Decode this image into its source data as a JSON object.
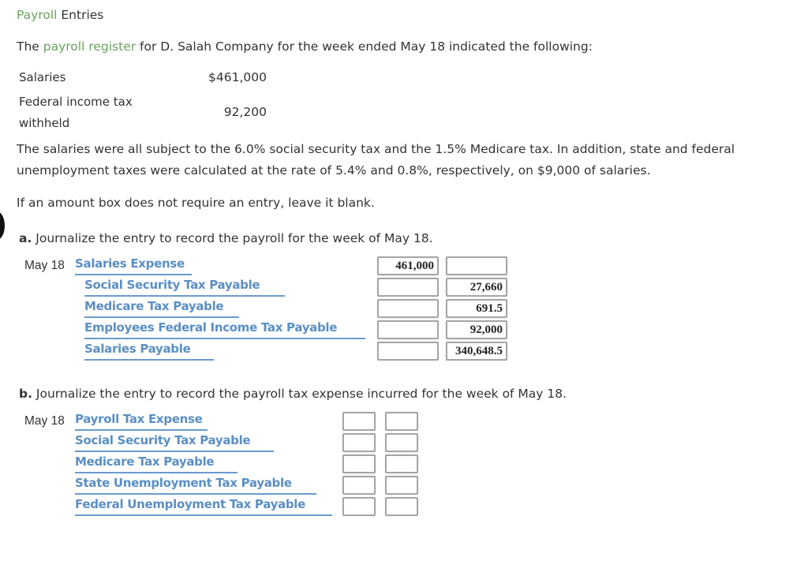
{
  "header": {
    "title_link": "Payroll",
    "title_rest": " Entries"
  },
  "intro": {
    "prefix": "The ",
    "link": "payroll register",
    "suffix": " for D. Salah Company for the week ended May 18 indicated the following:"
  },
  "register": [
    {
      "label": "Salaries",
      "value": "$461,000"
    },
    {
      "label_line1": "Federal income tax",
      "label_line2": "withheld",
      "value": "92,200"
    }
  ],
  "paragraphs": {
    "taxes_line1": "The salaries were all subject to the 6.0% social security tax and the 1.5% Medicare tax. In addition, state and federal",
    "taxes_line2": "unemployment taxes were calculated at the rate of 5.4% and 0.8%, respectively, on $9,000 of salaries.",
    "instruction": "If an amount box does not require an entry, leave it blank."
  },
  "part_a": {
    "letter": "a.",
    "prompt": " Journalize the entry to record the payroll for the week of May 18.",
    "date": "May 18",
    "rows": [
      {
        "account": "Salaries Expense",
        "debit": "461,000",
        "credit": ""
      },
      {
        "account": "Social Security Tax Payable",
        "debit": "",
        "credit": "27,660"
      },
      {
        "account": "Medicare Tax Payable",
        "debit": "",
        "credit": "691.5"
      },
      {
        "account": "Employees Federal Income Tax Payable",
        "debit": "",
        "credit": "92,000"
      },
      {
        "account": "Salaries Payable",
        "debit": "",
        "credit": "340,648.5"
      }
    ]
  },
  "part_b": {
    "letter": "b.",
    "prompt": " Journalize the entry to record the payroll tax expense incurred for the week of May 18.",
    "date": "May 18",
    "rows": [
      {
        "account": "Payroll Tax Expense",
        "debit": "",
        "credit": ""
      },
      {
        "account": "Social Security Tax Payable",
        "debit": "",
        "credit": ""
      },
      {
        "account": "Medicare Tax Payable",
        "debit": "",
        "credit": ""
      },
      {
        "account": "State Unemployment Tax Payable",
        "debit": "",
        "credit": ""
      },
      {
        "account": "Federal Unemployment Tax Payable",
        "debit": "",
        "credit": ""
      }
    ]
  }
}
